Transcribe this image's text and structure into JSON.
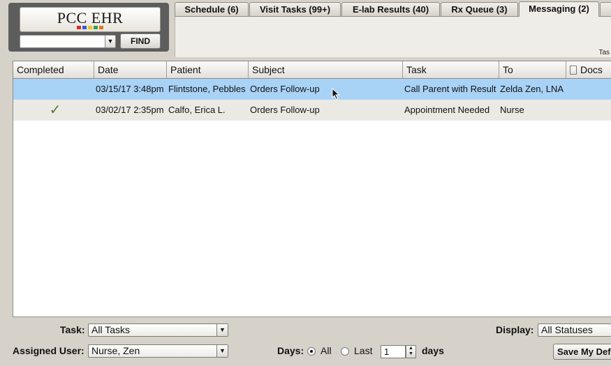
{
  "logo": {
    "text": "PCC EHR",
    "stripe_colors": [
      "#d62d2d",
      "#2f5fd0",
      "#f2c21b",
      "#33a24a",
      "#e07a1f"
    ]
  },
  "find": {
    "value": "",
    "button_label": "FIND"
  },
  "tabs": [
    {
      "label": "Schedule (6)",
      "active": false
    },
    {
      "label": "Visit Tasks (99+)",
      "active": false
    },
    {
      "label": "E-lab Results (40)",
      "active": false
    },
    {
      "label": "Rx Queue (3)",
      "active": false
    },
    {
      "label": "Messaging (2)",
      "active": true
    }
  ],
  "panel": {
    "tasks_label": "Tas"
  },
  "table": {
    "columns": [
      "Completed",
      "Date",
      "Patient",
      "Subject",
      "Task",
      "To",
      "Docs"
    ],
    "rows": [
      {
        "completed": "",
        "date": "03/15/17 3:48pm",
        "patient": "Flintstone, Pebbles",
        "subject": "Orders Follow-up",
        "task": "Call Parent with Result",
        "to": "Zelda Zen, LNA",
        "docs": "",
        "selected": true
      },
      {
        "completed": "✓",
        "date": "03/02/17 2:35pm",
        "patient": "Calfo, Erica L.",
        "subject": "Orders Follow-up",
        "task": "Appointment Needed",
        "to": "Nurse",
        "docs": "",
        "selected": false
      }
    ]
  },
  "filters": {
    "task_label": "Task:",
    "task_value": "All Tasks",
    "assigned_label": "Assigned User:",
    "assigned_value": "Nurse, Zen",
    "display_label": "Display:",
    "display_value": "All Statuses",
    "days_label": "Days:",
    "days_all": "All",
    "days_last": "Last",
    "days_value": "1",
    "days_unit": "days",
    "save_label": "Save My Defaults"
  },
  "colors": {
    "selected_row": "#a9d2f7",
    "alt_row": "#ebe9e4",
    "background": "#d6d2c9"
  }
}
